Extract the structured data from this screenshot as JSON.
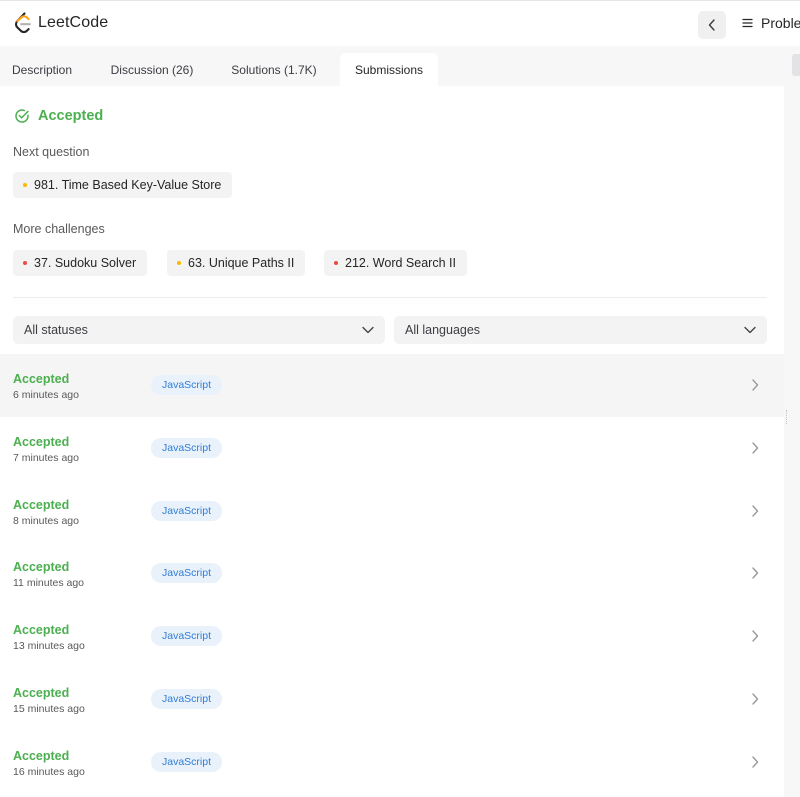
{
  "app": {
    "logo_text": "LeetCode",
    "problems_label": "Problems"
  },
  "colors": {
    "accepted": "#4caf50",
    "medium": "#ffb800",
    "hard": "#ef4743",
    "badge_bg": "#e9f1fb",
    "badge_text": "#2f7dd6"
  },
  "tabs": [
    {
      "label": "Description",
      "active": false
    },
    {
      "label": "Discussion (26)",
      "active": false
    },
    {
      "label": "Solutions (1.7K)",
      "active": false
    },
    {
      "label": "Submissions",
      "active": true
    }
  ],
  "result": {
    "status": "Accepted",
    "icon": "check-circle-icon"
  },
  "next_question": {
    "label": "Next question",
    "items": [
      {
        "title": "981. Time Based Key-Value Store",
        "difficulty": "medium"
      }
    ]
  },
  "more_challenges": {
    "label": "More challenges",
    "items": [
      {
        "title": "37. Sudoku Solver",
        "difficulty": "hard"
      },
      {
        "title": "63. Unique Paths II",
        "difficulty": "medium"
      },
      {
        "title": "212. Word Search II",
        "difficulty": "hard"
      }
    ]
  },
  "filters": {
    "status": {
      "selected": "All statuses"
    },
    "language": {
      "selected": "All languages"
    }
  },
  "submissions": [
    {
      "status": "Accepted",
      "time": "6 minutes ago",
      "language": "JavaScript"
    },
    {
      "status": "Accepted",
      "time": "7 minutes ago",
      "language": "JavaScript"
    },
    {
      "status": "Accepted",
      "time": "8 minutes ago",
      "language": "JavaScript"
    },
    {
      "status": "Accepted",
      "time": "11 minutes ago",
      "language": "JavaScript"
    },
    {
      "status": "Accepted",
      "time": "13 minutes ago",
      "language": "JavaScript"
    },
    {
      "status": "Accepted",
      "time": "15 minutes ago",
      "language": "JavaScript"
    },
    {
      "status": "Accepted",
      "time": "16 minutes ago",
      "language": "JavaScript"
    }
  ]
}
